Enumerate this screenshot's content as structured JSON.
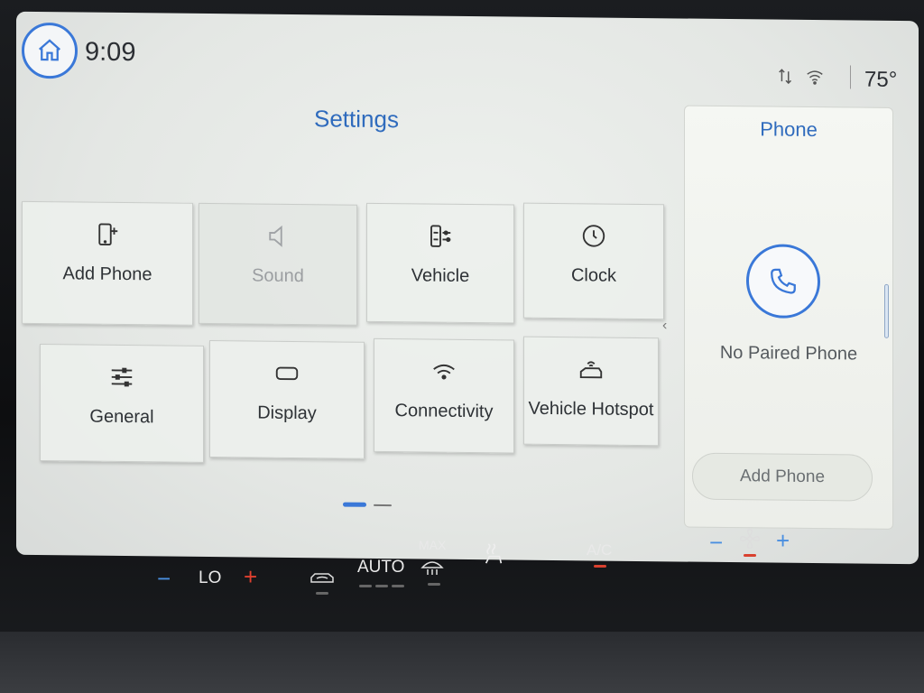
{
  "status": {
    "time": "9:09",
    "temperature": "75°",
    "icons": [
      "home-icon",
      "signal-arrows-icon",
      "wifi-icon"
    ]
  },
  "settings": {
    "title": "Settings",
    "tiles": [
      {
        "label": "Add Phone",
        "icon": "add-phone-icon",
        "enabled": true
      },
      {
        "label": "Sound",
        "icon": "speaker-icon",
        "enabled": false
      },
      {
        "label": "Vehicle",
        "icon": "vehicle-settings-icon",
        "enabled": true
      },
      {
        "label": "Clock",
        "icon": "clock-icon",
        "enabled": true
      },
      {
        "label": "General",
        "icon": "sliders-icon",
        "enabled": true
      },
      {
        "label": "Display",
        "icon": "display-icon",
        "enabled": true
      },
      {
        "label": "Connectivity",
        "icon": "wifi-icon",
        "enabled": true
      },
      {
        "label": "Vehicle Hotspot",
        "icon": "hotspot-icon",
        "enabled": true
      }
    ],
    "pages": 2,
    "current_page": 1
  },
  "phone_panel": {
    "title": "Phone",
    "status": "No Paired Phone",
    "button": "Add Phone",
    "icon": "phone-icon"
  },
  "climate": {
    "fan_speed": "LO",
    "auto": "AUTO",
    "max": "MAX",
    "ac": "A/C",
    "minus": "−",
    "plus": "+"
  },
  "colors": {
    "accent": "#3a78d8",
    "title": "#2f6bbd",
    "minus": "#4a8fe0",
    "plus": "#e0402f"
  }
}
